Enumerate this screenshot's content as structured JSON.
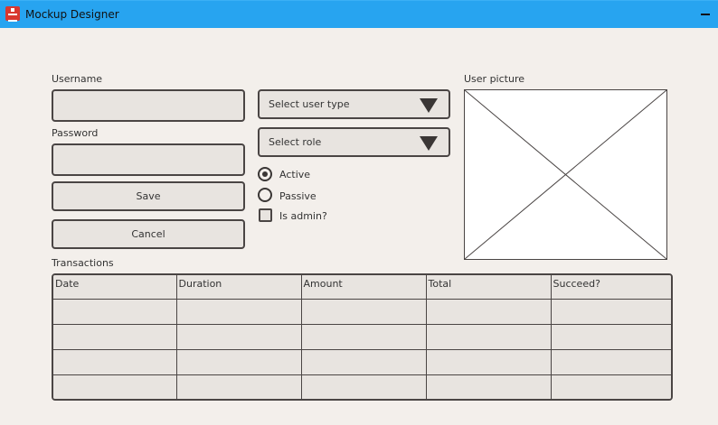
{
  "window": {
    "title": "Mockup Designer",
    "accent": "#27a4f0"
  },
  "form": {
    "username_label": "Username",
    "username_value": "",
    "password_label": "Password",
    "password_value": "",
    "save_label": "Save",
    "cancel_label": "Cancel",
    "user_type_select": "Select user type",
    "role_select": "Select role",
    "radios": [
      {
        "label": "Active",
        "checked": true
      },
      {
        "label": "Passive",
        "checked": false
      }
    ],
    "is_admin_label": "Is admin?",
    "is_admin_checked": false,
    "picture_label": "User picture"
  },
  "transactions": {
    "label": "Transactions",
    "columns": [
      "Date",
      "Duration",
      "Amount",
      "Total",
      "Succeed?"
    ],
    "rows": [
      [
        "",
        "",
        "",
        "",
        ""
      ],
      [
        "",
        "",
        "",
        "",
        ""
      ],
      [
        "",
        "",
        "",
        "",
        ""
      ],
      [
        "",
        "",
        "",
        "",
        ""
      ]
    ]
  }
}
